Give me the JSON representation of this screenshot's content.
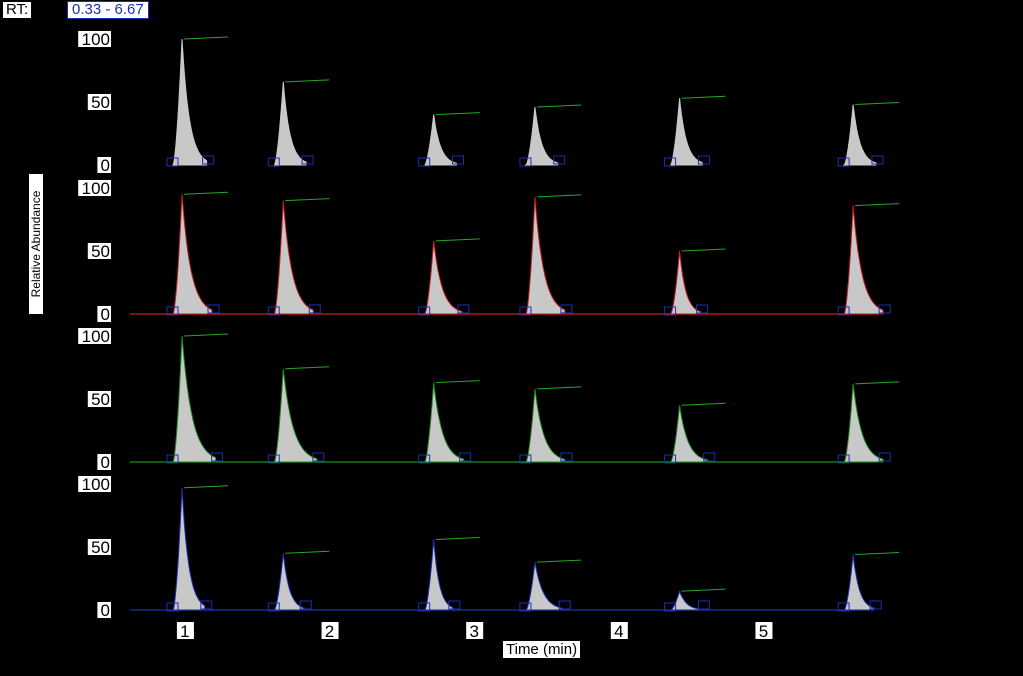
{
  "header": {
    "rt_label": "RT:",
    "rt_value": "0.33 - 6.67"
  },
  "colors": {
    "background": "#000000",
    "peak_fill": "#c8c8c8",
    "label_bg": "#ffffff",
    "baseline_marker": "#1c2fb0",
    "annotation_line": "#22aa22"
  },
  "chart_data": {
    "type": "area",
    "xlabel": "Time (min)",
    "ylabel": "Relative Abundance",
    "xlim": [
      0.33,
      6.67
    ],
    "x_ticks": [
      1,
      2,
      3,
      4,
      5
    ],
    "ylim": [
      0,
      100
    ],
    "y_ticks": [
      0,
      50,
      100
    ],
    "panels": [
      {
        "trace_color": "#c8c8c8",
        "peaks": [
          {
            "rt": 0.98,
            "height": 100,
            "tail": 0.7
          },
          {
            "rt": 1.68,
            "height": 66,
            "tail": 0.6
          },
          {
            "rt": 2.72,
            "height": 40,
            "tail": 0.6
          },
          {
            "rt": 3.42,
            "height": 46,
            "tail": 0.6
          },
          {
            "rt": 4.42,
            "height": 53,
            "tail": 0.6
          },
          {
            "rt": 5.62,
            "height": 48,
            "tail": 0.6
          }
        ]
      },
      {
        "trace_color": "#c81e1e",
        "peaks": [
          {
            "rt": 0.98,
            "height": 95,
            "tail": 1.0
          },
          {
            "rt": 1.68,
            "height": 90,
            "tail": 1.0
          },
          {
            "rt": 2.72,
            "height": 58,
            "tail": 0.9
          },
          {
            "rt": 3.42,
            "height": 93,
            "tail": 1.0
          },
          {
            "rt": 4.42,
            "height": 50,
            "tail": 0.5
          },
          {
            "rt": 5.62,
            "height": 86,
            "tail": 1.0
          }
        ]
      },
      {
        "trace_color": "#1e8c1e",
        "peaks": [
          {
            "rt": 0.98,
            "height": 100,
            "tail": 1.2
          },
          {
            "rt": 1.68,
            "height": 74,
            "tail": 1.2
          },
          {
            "rt": 2.72,
            "height": 63,
            "tail": 1.0
          },
          {
            "rt": 3.42,
            "height": 58,
            "tail": 1.0
          },
          {
            "rt": 4.42,
            "height": 45,
            "tail": 0.9
          },
          {
            "rt": 5.62,
            "height": 62,
            "tail": 1.0
          }
        ]
      },
      {
        "trace_color": "#1c2fb0",
        "peaks": [
          {
            "rt": 0.98,
            "height": 97,
            "tail": 0.6
          },
          {
            "rt": 1.68,
            "height": 45,
            "tail": 0.5
          },
          {
            "rt": 2.72,
            "height": 56,
            "tail": 0.4
          },
          {
            "rt": 3.42,
            "height": 38,
            "tail": 0.9
          },
          {
            "rt": 4.42,
            "height": 15,
            "tail": 0.6
          },
          {
            "rt": 5.62,
            "height": 44,
            "tail": 0.5
          }
        ]
      }
    ]
  }
}
